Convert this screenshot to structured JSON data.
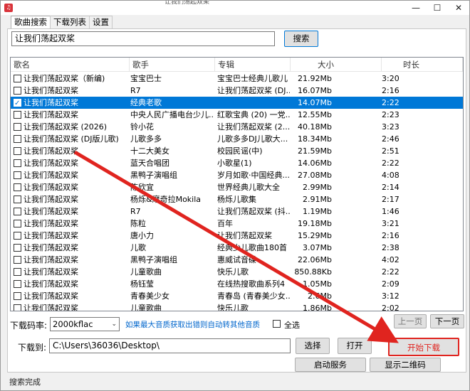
{
  "window": {
    "app_icon_text": "♫",
    "title": "让我们荡起双桨",
    "minimize": "—",
    "maximize": "☐",
    "close": "✕"
  },
  "tabs": [
    {
      "label": "歌曲搜索",
      "active": true
    },
    {
      "label": "下载列表",
      "active": false
    },
    {
      "label": "设置",
      "active": false
    }
  ],
  "search": {
    "value": "让我们荡起双桨",
    "button": "搜索"
  },
  "columns": [
    "歌名",
    "歌手",
    "专辑",
    "大小",
    "时长"
  ],
  "rows": [
    {
      "name": "让我们荡起双桨（新编)",
      "singer": "宝宝巴士",
      "album": "宝宝巴士经典儿歌儿",
      "size": "21.92Mb",
      "duration": "3:20",
      "checked": false,
      "selected": false
    },
    {
      "name": "让我们荡起双桨",
      "singer": "R7",
      "album": "让我们荡起双桨 (DJ...",
      "size": "16.07Mb",
      "duration": "2:16",
      "checked": false,
      "selected": false
    },
    {
      "name": "让我们荡起双桨",
      "singer": "经典老歌",
      "album": "",
      "size": "14.07Mb",
      "duration": "2:22",
      "checked": true,
      "selected": true
    },
    {
      "name": "让我们荡起双桨",
      "singer": "中央人民广播电台少儿...",
      "album": "红歌宝典 (20) 一党...",
      "size": "12.55Mb",
      "duration": "2:23",
      "checked": false,
      "selected": false
    },
    {
      "name": "让我们荡起双桨 (2026)",
      "singer": "铃小花",
      "album": "让我们荡起双桨 (2...",
      "size": "40.18Mb",
      "duration": "3:23",
      "checked": false,
      "selected": false
    },
    {
      "name": "让我们荡起双桨 (DJ版儿歌)",
      "singer": "儿歌多多",
      "album": "儿歌多多DJ儿歌大...",
      "size": "18.34Mb",
      "duration": "2:46",
      "checked": false,
      "selected": false
    },
    {
      "name": "让我们荡起双桨",
      "singer": "十二大美女",
      "album": "校园民谣(中)",
      "size": "21.59Mb",
      "duration": "2:51",
      "checked": false,
      "selected": false
    },
    {
      "name": "让我们荡起双桨",
      "singer": "蓝天合唱团",
      "album": "小歌星(1)",
      "size": "14.06Mb",
      "duration": "2:22",
      "checked": false,
      "selected": false
    },
    {
      "name": "让我们荡起双桨",
      "singer": "黑鸭子演唱组",
      "album": "岁月如歌·中国经典...",
      "size": "27.08Mb",
      "duration": "4:08",
      "checked": false,
      "selected": false
    },
    {
      "name": "让我们荡起双桨",
      "singer": "陈欣宜",
      "album": "世界经典儿歌大全",
      "size": "2.99Mb",
      "duration": "2:14",
      "checked": false,
      "selected": false
    },
    {
      "name": "让我们荡起双桨",
      "singer": "杨烁&摩奇拉Mokila",
      "album": "杨烁儿歌集",
      "size": "2.91Mb",
      "duration": "2:17",
      "checked": false,
      "selected": false
    },
    {
      "name": "让我们荡起双桨",
      "singer": "R7",
      "album": "让我们荡起双桨 (抖...",
      "size": "1.19Mb",
      "duration": "1:46",
      "checked": false,
      "selected": false
    },
    {
      "name": "让我们荡起双桨",
      "singer": "陈粒",
      "album": "百年",
      "size": "19.18Mb",
      "duration": "3:21",
      "checked": false,
      "selected": false
    },
    {
      "name": "让我们荡起双桨",
      "singer": "唐小力",
      "album": "让我们荡起双桨",
      "size": "15.29Mb",
      "duration": "2:16",
      "checked": false,
      "selected": false
    },
    {
      "name": "让我们荡起双桨",
      "singer": "儿歌",
      "album": "经典少儿歌曲180首",
      "size": "3.07Mb",
      "duration": "2:38",
      "checked": false,
      "selected": false
    },
    {
      "name": "让我们荡起双桨",
      "singer": "黑鸭子演唱组",
      "album": "惠威试音碟",
      "size": "22.06Mb",
      "duration": "4:02",
      "checked": false,
      "selected": false
    },
    {
      "name": "让我们荡起双桨",
      "singer": "儿童歌曲",
      "album": "快乐儿歌",
      "size": "850.88Kb",
      "duration": "2:22",
      "checked": false,
      "selected": false
    },
    {
      "name": "让我们荡起双桨",
      "singer": "杨钰莹",
      "album": "在线热搜歌曲系列4",
      "size": "1.05Mb",
      "duration": "2:09",
      "checked": false,
      "selected": false
    },
    {
      "name": "让我们荡起双桨",
      "singer": "青春美少女",
      "album": "青春岛 (青春美少女...",
      "size": "2.6Mb",
      "duration": "3:12",
      "checked": false,
      "selected": false
    },
    {
      "name": "让我们荡起双桨",
      "singer": "儿童歌曲",
      "album": "快乐儿歌",
      "size": "1.86Mb",
      "duration": "2:02",
      "checked": false,
      "selected": false
    }
  ],
  "pager": {
    "prev": "上一页",
    "next": "下一页"
  },
  "bitrate": {
    "label": "下载码率:",
    "value": "2000kflac",
    "hint": "如果最大音质获取出错则自动转其他音质",
    "select_all": "全选"
  },
  "download": {
    "label": "下载到:",
    "path": "C:\\Users\\36036\\Desktop\\",
    "choose": "选择",
    "open": "打开",
    "start": "开始下载",
    "service": "启动服务",
    "qr": "显示二维码"
  },
  "status": "搜索完成",
  "colors": {
    "selection": "#0078d7",
    "accent_red": "#e0241f",
    "hint_blue": "#0066cc"
  }
}
